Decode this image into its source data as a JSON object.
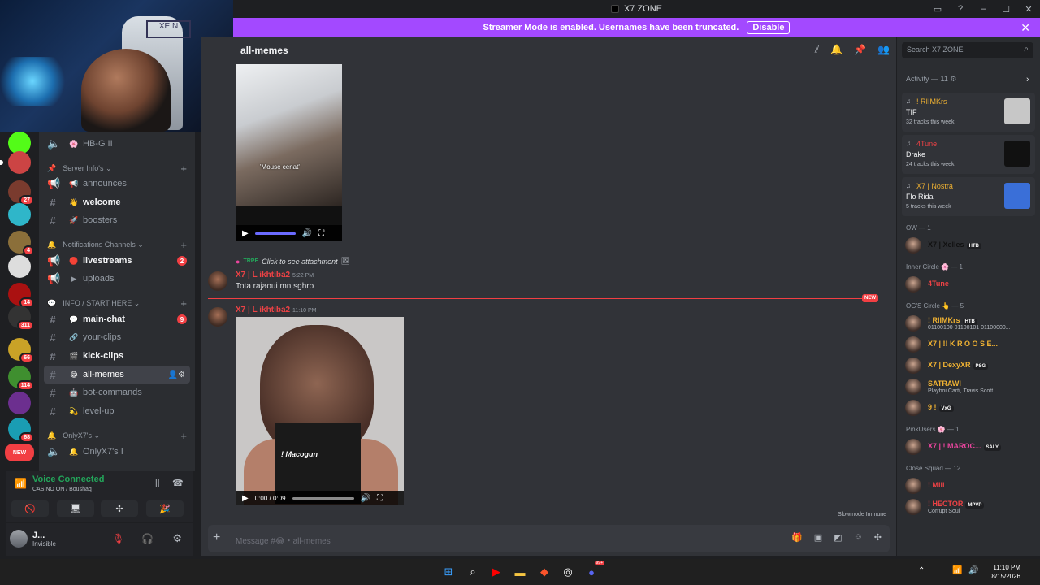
{
  "window": {
    "title": "X7 ZONE"
  },
  "banner": {
    "text": "Streamer Mode is enabled. Usernames have been truncated.",
    "button": "Disable"
  },
  "servers": {
    "badges": [
      "27",
      "4",
      "14",
      "311",
      "66",
      "114",
      "68"
    ],
    "new_label": "NEW"
  },
  "channels": [
    {
      "kind": "voice",
      "name": "HB-G II",
      "emoji": "🌸",
      "state": "muted"
    },
    {
      "kind": "category",
      "name": "Server Info's"
    },
    {
      "kind": "announce",
      "name": "announces",
      "emoji": "📢",
      "state": "muted"
    },
    {
      "kind": "text",
      "name": "welcome",
      "emoji": "👋",
      "state": "unread"
    },
    {
      "kind": "text",
      "name": "boosters",
      "emoji": "🚀",
      "state": "muted"
    },
    {
      "kind": "category",
      "name": "Notifications Channels"
    },
    {
      "kind": "announce",
      "name": "livestreams",
      "emoji": "🔴",
      "state": "unread",
      "mentions": "2"
    },
    {
      "kind": "announce",
      "name": "uploads",
      "emoji": "▶",
      "state": "muted"
    },
    {
      "kind": "category",
      "name": "INFO / START HERE"
    },
    {
      "kind": "text",
      "name": "main-chat",
      "emoji": "💬",
      "state": "unread",
      "mentions": "9"
    },
    {
      "kind": "text",
      "name": "your-clips",
      "emoji": "🔗",
      "state": "muted"
    },
    {
      "kind": "text",
      "name": "kick-clips",
      "emoji": "🎬",
      "state": "unread"
    },
    {
      "kind": "text",
      "name": "all-memes",
      "emoji": "😂",
      "state": "active"
    },
    {
      "kind": "text",
      "name": "bot-commands",
      "emoji": "🤖",
      "state": "muted"
    },
    {
      "kind": "text",
      "name": "level-up",
      "emoji": "💫",
      "state": "muted"
    },
    {
      "kind": "category",
      "name": "OnlyX7's"
    },
    {
      "kind": "voice",
      "name": "OnlyX7's I",
      "emoji": "🔔",
      "state": "muted"
    }
  ],
  "voice": {
    "title": "Voice Connected",
    "sub": "CASINO ON / Boushaq"
  },
  "user": {
    "name": "J...",
    "status": "Invisible"
  },
  "chat": {
    "channel": "all-memes",
    "video1_caption": "'Mouse cenat'",
    "reply_label": "TRPE",
    "reply_text": "Click to see attachment",
    "msg1": {
      "user": "X7 | L ikhtiba2",
      "time": "5:22 PM",
      "text": "Tota rajaoui mn sghro"
    },
    "new_label": "NEW",
    "msg2": {
      "user": "X7 | L ikhtiba2",
      "time": "11:10 PM"
    },
    "video2": {
      "time": "0:00 / 0:09",
      "inset_name": "! Macogun"
    },
    "slowmode": "Slowmode Immune",
    "composer_placeholder": "Message #😂・all-memes"
  },
  "right": {
    "search_placeholder": "Search X7 ZONE",
    "activity_header": "Activity — 11",
    "activity": [
      {
        "user": "! RIIMKrs",
        "user_color": "#f0b232",
        "artist": "TIF",
        "count": "32 tracks this week",
        "art": "#c7c7c7"
      },
      {
        "user": "4Tune",
        "user_color": "#ed4245",
        "artist": "Drake",
        "count": "24 tracks this week",
        "art": "#111111"
      },
      {
        "user": "X7 | Nostra",
        "user_color": "#f0b232",
        "artist": "Flo Rida",
        "count": "5 tracks this week",
        "art": "#3a6fd8"
      }
    ],
    "groups": [
      {
        "title": "OW — 1",
        "members": [
          {
            "name": "X7 | Xelles",
            "tag": "HTB",
            "color": "#111111",
            "sub": ""
          }
        ]
      },
      {
        "title": "Inner Circle 🌸 — 1",
        "members": [
          {
            "name": "4Tune",
            "tag": "",
            "color": "#ed4245",
            "sub": ""
          }
        ]
      },
      {
        "title": "OG'S Circle 👆 — 5",
        "members": [
          {
            "name": "! RIIMKrs",
            "tag": "HTB",
            "color": "#f0b232",
            "sub": "01100100 01100101 01100000..."
          },
          {
            "name": "X7 | !! K R O O S E...",
            "tag": "",
            "color": "#f0b232",
            "sub": ""
          },
          {
            "name": "X7 | DexyXR",
            "tag": "PSG",
            "color": "#f0b232",
            "sub": ""
          },
          {
            "name": "SATRAWI",
            "tag": "",
            "color": "#f0b232",
            "sub": "Playboi Carti, Travis Scott"
          },
          {
            "name": "9 !",
            "tag": "VxG",
            "color": "#f0b232",
            "sub": ""
          }
        ]
      },
      {
        "title": "PinkUsers 🌸 — 1",
        "members": [
          {
            "name": "X7 | ! MAROC...",
            "tag": "SALY",
            "color": "#eb459e",
            "sub": ""
          }
        ]
      },
      {
        "title": "Close Squad — 12",
        "members": [
          {
            "name": "! Mill",
            "tag": "",
            "color": "#ed4245",
            "sub": ""
          },
          {
            "name": "! HECTOR",
            "tag": "MPVP",
            "color": "#ed4245",
            "sub": "Corrupt Soul"
          }
        ]
      }
    ]
  },
  "taskbar": {
    "time": "11:10 PM",
    "date": "8/15/2026",
    "discord_badge": "99+"
  }
}
